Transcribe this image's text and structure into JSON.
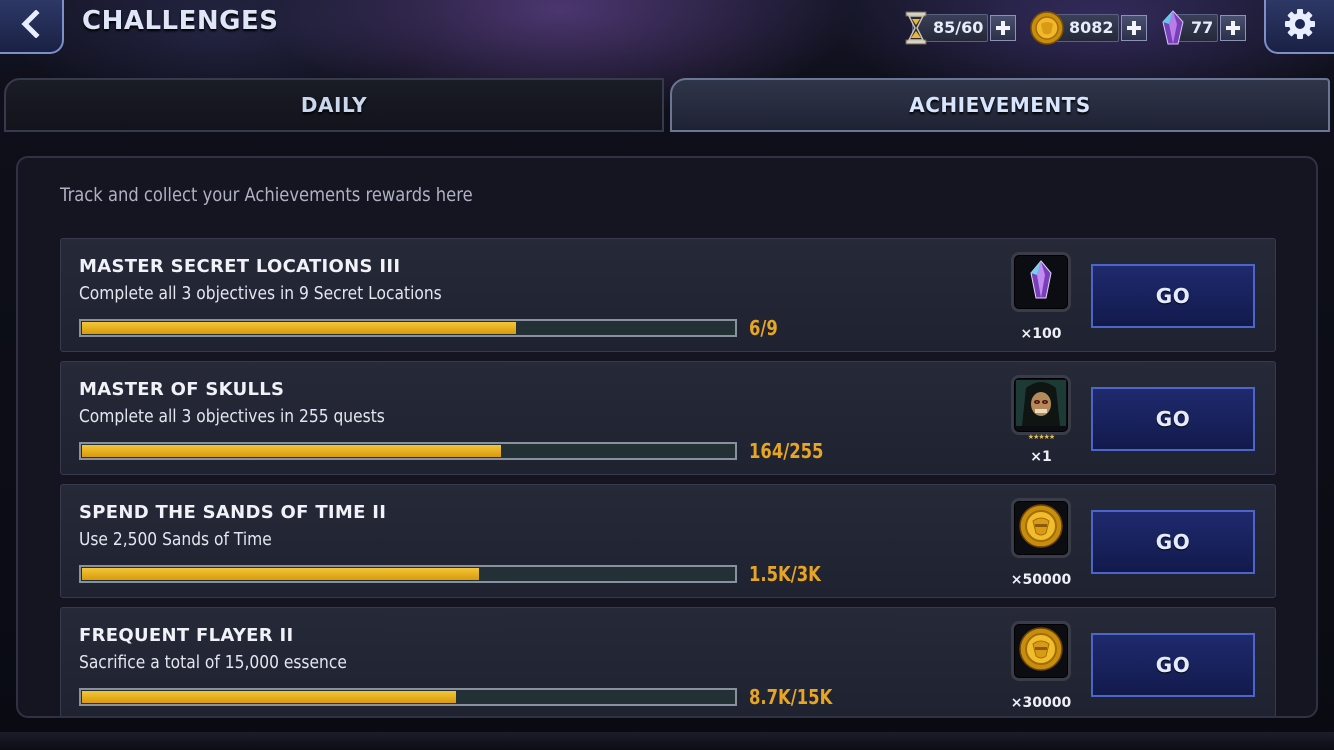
{
  "header": {
    "title": "CHALLENGES",
    "back_icon": "chevron-left-icon",
    "settings_icon": "gear-icon"
  },
  "currencies": [
    {
      "name": "energy",
      "icon": "hourglass-icon",
      "value": "85/60"
    },
    {
      "name": "gold",
      "icon": "gold-coin-icon",
      "value": "8082"
    },
    {
      "name": "units",
      "icon": "crystal-icon",
      "value": "77"
    }
  ],
  "tabs": [
    {
      "label": "DAILY",
      "selected": false
    },
    {
      "label": "ACHIEVEMENTS",
      "selected": true
    }
  ],
  "panel": {
    "subtitle": "Track and collect your Achievements rewards here"
  },
  "achievements": [
    {
      "title": "MASTER SECRET LOCATIONS III",
      "description": "Complete all 3 objectives in 9 Secret Locations",
      "progress_label": "6/9",
      "progress": 0.667,
      "reward_icon": "crystal-icon",
      "reward_qty": "×100",
      "button": "GO"
    },
    {
      "title": "MASTER OF SKULLS",
      "description": "Complete all 3 objectives in 255 quests",
      "progress_label": "164/255",
      "progress": 0.643,
      "reward_icon": "champion-portrait-icon",
      "reward_qty": "×1",
      "reward_stars": "★★★★★",
      "button": "GO"
    },
    {
      "title": "SPEND THE SANDS OF TIME II",
      "description": "Use 2,500 Sands of Time",
      "progress_label": "1.5K/3K",
      "progress": 0.61,
      "reward_icon": "gold-coin-icon",
      "reward_qty": "×50000",
      "button": "GO"
    },
    {
      "title": "FREQUENT FLAYER II",
      "description": "Sacrifice a total of 15,000 essence",
      "progress_label": "8.7K/15K",
      "progress": 0.575,
      "reward_icon": "gold-coin-icon",
      "reward_qty": "×30000",
      "button": "GO"
    }
  ],
  "colors": {
    "progress_fill": "#f3c63a",
    "progress_text": "#e7a523",
    "go_button": "#1f2a6e"
  }
}
